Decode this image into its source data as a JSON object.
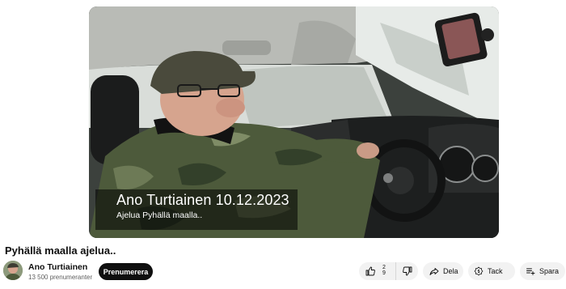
{
  "video": {
    "caption_title": "Ano Turtiainen 10.12.2023",
    "caption_subtitle": "Ajelua Pyhällä maalla.."
  },
  "title": "Pyhällä maalla ajelua..",
  "channel": {
    "name": "Ano Turtiainen",
    "subscribers": "13 500 prenumeranter",
    "subscribe_label": "Prenumerera"
  },
  "actions": {
    "like_count_top": "2",
    "like_count_bottom": "9",
    "share_label": "Dela",
    "thanks_label": "Tack",
    "save_label": "Spara"
  },
  "icons": {
    "like": "thumbs-up-icon",
    "dislike": "thumbs-down-icon",
    "share": "share-arrow-icon",
    "thanks": "thanks-dollar-icon",
    "save": "playlist-add-icon"
  },
  "colors": {
    "subscribe_bg": "#0f0f0f",
    "pill_bg": "#f2f2f2",
    "text_primary": "#0f0f0f",
    "text_secondary": "#606060"
  }
}
